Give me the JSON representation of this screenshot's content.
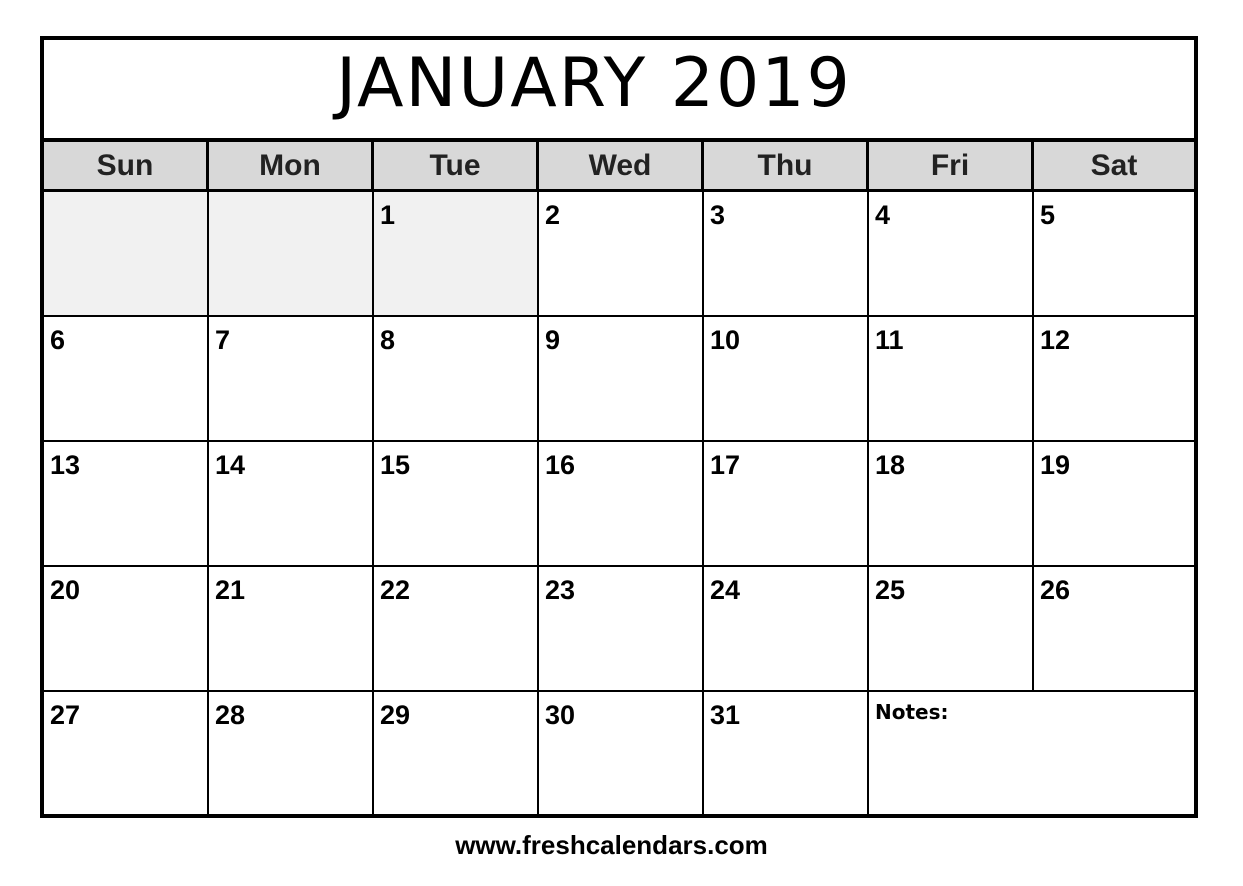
{
  "calendar": {
    "title": "JANUARY 2019",
    "weekdays": [
      "Sun",
      "Mon",
      "Tue",
      "Wed",
      "Thu",
      "Fri",
      "Sat"
    ],
    "weeks": [
      [
        "",
        "",
        "1",
        "2",
        "3",
        "4",
        "5"
      ],
      [
        "6",
        "7",
        "8",
        "9",
        "10",
        "11",
        "12"
      ],
      [
        "13",
        "14",
        "15",
        "16",
        "17",
        "18",
        "19"
      ],
      [
        "20",
        "21",
        "22",
        "23",
        "24",
        "25",
        "26"
      ],
      [
        "27",
        "28",
        "29",
        "30",
        "31"
      ]
    ],
    "notes_label": "Notes:"
  },
  "footer": {
    "url": "www.freshcalendars.com"
  }
}
